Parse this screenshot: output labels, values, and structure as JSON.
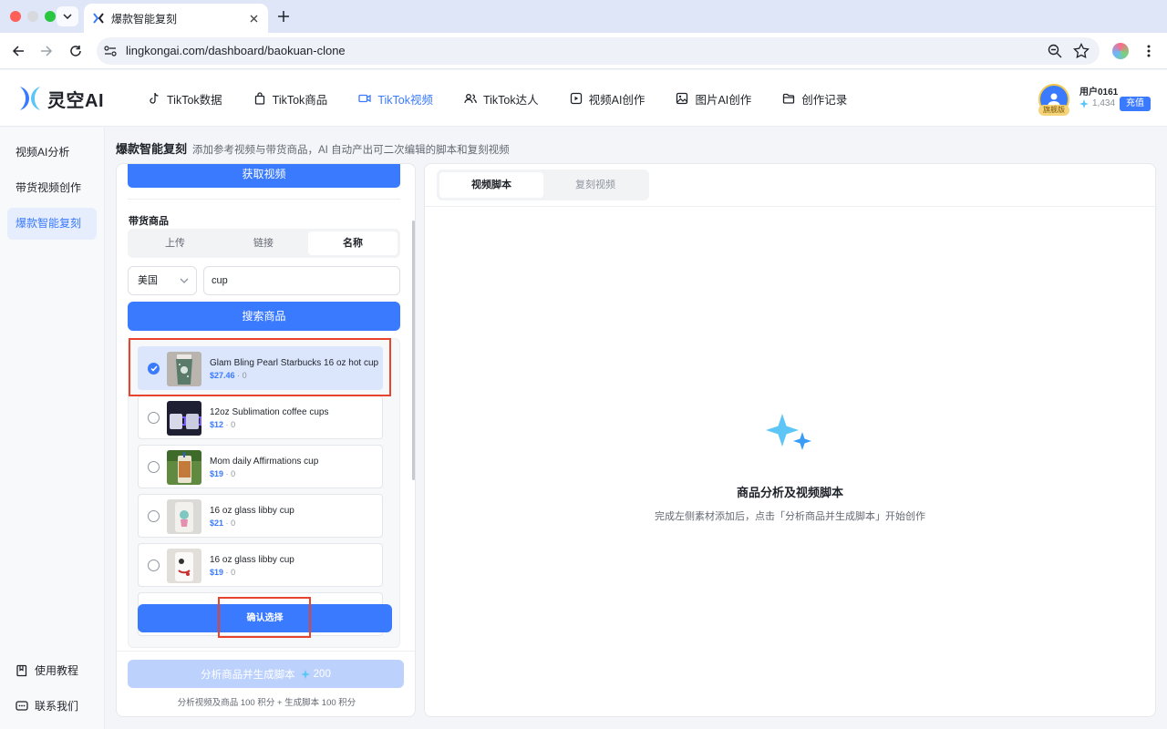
{
  "browser": {
    "tab_title": "爆款智能复刻",
    "url": "lingkongai.com/dashboard/baokuan-clone"
  },
  "header": {
    "logo_text": "灵空AI",
    "nav": [
      {
        "label": "TikTok数据",
        "icon": "tiktok-icon"
      },
      {
        "label": "TikTok商品",
        "icon": "shopping-bag-icon"
      },
      {
        "label": "TikTok视频",
        "icon": "video-camera-icon",
        "active": true
      },
      {
        "label": "TikTok达人",
        "icon": "users-icon"
      },
      {
        "label": "视频AI创作",
        "icon": "video-ai-icon"
      },
      {
        "label": "图片AI创作",
        "icon": "image-icon"
      },
      {
        "label": "创作记录",
        "icon": "folder-icon"
      }
    ],
    "user": {
      "name": "用户0161",
      "badge": "旗舰版",
      "credits": "1,434",
      "recharge_label": "充值"
    }
  },
  "sidebar": {
    "items": [
      {
        "label": "视频AI分析"
      },
      {
        "label": "带货视频创作"
      },
      {
        "label": "爆款智能复刻",
        "active": true
      }
    ],
    "footer": [
      {
        "label": "使用教程",
        "icon": "book-icon"
      },
      {
        "label": "联系我们",
        "icon": "chat-icon"
      }
    ]
  },
  "page": {
    "title": "爆款智能复刻",
    "subtitle": "添加参考视频与带货商品，AI 自动产出可二次编辑的脚本和复刻视频"
  },
  "left_panel": {
    "fetch_label": "获取视频",
    "product_section_label": "带货商品",
    "segments": [
      "上传",
      "链接",
      "名称"
    ],
    "active_segment": "名称",
    "country": "美国",
    "search_value": "cup",
    "search_button": "搜索商品",
    "products": [
      {
        "name": "Glam Bling Pearl Starbucks 16 oz hot cup",
        "price": "$27.46",
        "sales": "0",
        "selected": true
      },
      {
        "name": "12oz Sublimation coffee cups",
        "price": "$12",
        "sales": "0",
        "selected": false
      },
      {
        "name": "Mom daily Affirmations cup",
        "price": "$19",
        "sales": "0",
        "selected": false
      },
      {
        "name": "16 oz glass libby cup",
        "price": "$21",
        "sales": "0",
        "selected": false
      },
      {
        "name": "16 oz glass libby cup",
        "price": "$19",
        "sales": "0",
        "selected": false
      }
    ],
    "separator": "·",
    "confirm_label": "确认选择",
    "analyze_label": "分析商品并生成脚本",
    "analyze_cost": "200",
    "analyze_note": "分析视频及商品 100 积分 + 生成脚本 100 积分"
  },
  "right_panel": {
    "tabs": [
      "视频脚本",
      "复刻视频"
    ],
    "active_tab": "视频脚本",
    "empty_title": "商品分析及视频脚本",
    "empty_subtitle": "完成左侧素材添加后，点击「分析商品并生成脚本」开始创作"
  },
  "colors": {
    "accent": "#3a7afe",
    "accent_light": "#bcd1fc",
    "selected_bg": "#dbe6fd",
    "highlight": "#e8442d"
  }
}
